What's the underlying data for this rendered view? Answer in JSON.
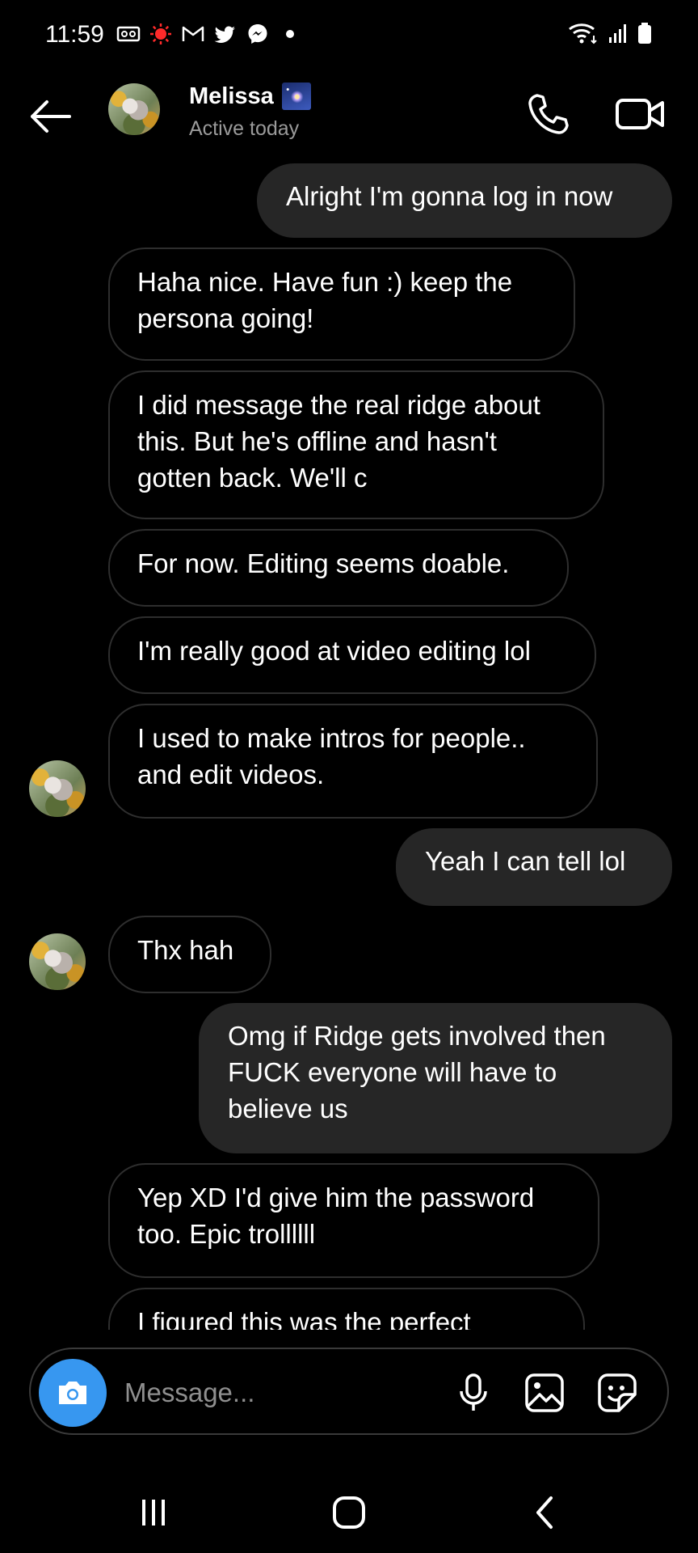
{
  "status_bar": {
    "time": "11:59"
  },
  "header": {
    "name": "Melissa",
    "status": "Active today"
  },
  "messages": [
    {
      "from": "me",
      "text": "Alright I'm gonna log in now"
    },
    {
      "from": "them",
      "text": "Haha nice. Have fun :) keep the persona going!"
    },
    {
      "from": "them",
      "text": "I did message the real ridge about this. But he's offline and hasn't gotten back. We'll c"
    },
    {
      "from": "them",
      "text": "For now. Editing seems doable."
    },
    {
      "from": "them",
      "text": "I'm really good at video editing lol"
    },
    {
      "from": "them",
      "text": "I used to make intros for people.. and edit videos."
    },
    {
      "from": "me",
      "text": "Yeah I can tell lol"
    },
    {
      "from": "them",
      "text": "Thx hah"
    },
    {
      "from": "me",
      "text": "Omg if Ridge gets involved then FUCK everyone will have to believe us"
    },
    {
      "from": "them",
      "text": "Yep XD I'd give him the password too. Epic trollllll"
    },
    {
      "from": "them",
      "text": "I figured this was the perfect"
    }
  ],
  "composer": {
    "placeholder": "Message..."
  },
  "icons": {
    "back": "arrow-left-icon",
    "call": "phone-icon",
    "video": "video-camera-icon",
    "camera": "camera-icon",
    "mic": "microphone-icon",
    "gallery": "image-icon",
    "sticker": "sticker-icon"
  },
  "colors": {
    "background": "#000000",
    "outgoing_bubble": "#262626",
    "incoming_border": "#2e2e2e",
    "camera_button": "#3797f0",
    "secondary_text": "#9a9a9a"
  }
}
